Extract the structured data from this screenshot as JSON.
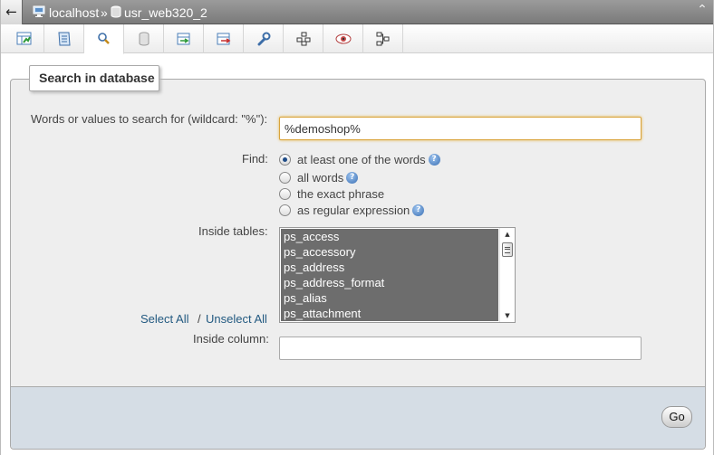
{
  "breadcrumb": {
    "back_symbol": "←",
    "server": "localhost",
    "separator": "»",
    "database": "usr_web320_2",
    "collapse_symbol": "⌃"
  },
  "tabs": [
    {
      "id": "structure",
      "icon": "structure-icon"
    },
    {
      "id": "sql",
      "icon": "sql-icon"
    },
    {
      "id": "search",
      "icon": "search-icon",
      "active": true
    },
    {
      "id": "query",
      "icon": "query-icon"
    },
    {
      "id": "export",
      "icon": "export-icon"
    },
    {
      "id": "import",
      "icon": "import-icon"
    },
    {
      "id": "operations",
      "icon": "wrench-icon"
    },
    {
      "id": "routines",
      "icon": "routines-icon"
    },
    {
      "id": "tracking",
      "icon": "eye-icon"
    },
    {
      "id": "designer",
      "icon": "designer-icon"
    }
  ],
  "search": {
    "legend": "Search in database",
    "words_label": "Words or values to search for (wildcard: \"%\"):",
    "words_value": "%demoshop%",
    "find_label": "Find:",
    "options": [
      {
        "label": "at least one of the words",
        "checked": true,
        "help": true
      },
      {
        "label": "all words",
        "checked": false,
        "help": true
      },
      {
        "label": "the exact phrase",
        "checked": false,
        "help": false
      },
      {
        "label": "as regular expression",
        "checked": false,
        "help": true
      }
    ],
    "help_symbol": "?",
    "tables_label": "Inside tables:",
    "tables": [
      "ps_access",
      "ps_accessory",
      "ps_address",
      "ps_address_format",
      "ps_alias",
      "ps_attachment"
    ],
    "select_all": "Select All",
    "unselect_sep": "/",
    "unselect_all": "Unselect All",
    "column_label": "Inside column:",
    "column_value": "",
    "go_label": "Go"
  },
  "colors": {
    "topbar": "#888888",
    "panel": "#eeeeee",
    "footer": "#d5dde5",
    "selected_option": "#6d6d6d",
    "link": "#235a81",
    "input_focus": "#d9a33b"
  }
}
